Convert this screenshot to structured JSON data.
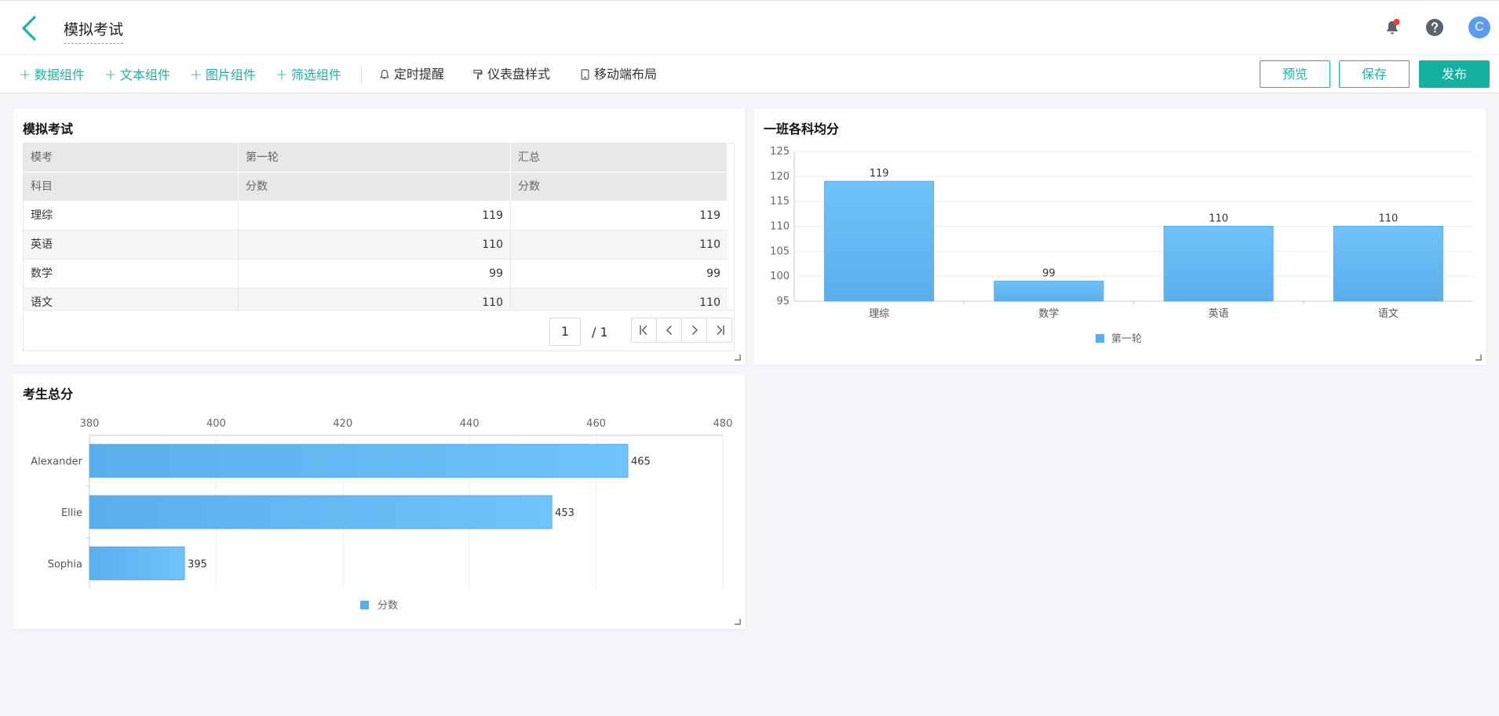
{
  "header": {
    "title": "模拟考试",
    "avatar_letter": "C"
  },
  "toolbar": {
    "add_items": [
      "数据组件",
      "文本组件",
      "图片组件",
      "筛选组件"
    ],
    "tools": [
      "定时提醒",
      "仪表盘样式",
      "移动端布局"
    ],
    "preview_label": "预览",
    "save_label": "保存",
    "publish_label": "发布"
  },
  "colors": {
    "accent": "#1bb3a3",
    "bar": "#64b8f6",
    "notification_dot": "#f04134"
  },
  "table_card": {
    "title": "模拟考试",
    "header_row1": [
      "模考",
      "第一轮",
      "汇总"
    ],
    "header_row2": [
      "科目",
      "分数",
      "分数"
    ],
    "rows": [
      [
        "理综",
        "119",
        "119"
      ],
      [
        "英语",
        "110",
        "110"
      ],
      [
        "数学",
        "99",
        "99"
      ],
      [
        "语文",
        "110",
        "110"
      ]
    ],
    "pager": {
      "current": "1",
      "total": "/ 1"
    }
  },
  "bar_card": {
    "title": "一班各科均分"
  },
  "hbar_card": {
    "title": "考生总分"
  },
  "chart_data": [
    {
      "type": "bar",
      "title": "一班各科均分",
      "categories": [
        "理综",
        "数学",
        "英语",
        "语文"
      ],
      "series": [
        {
          "name": "第一轮",
          "values": [
            119,
            99,
            110,
            110
          ]
        }
      ],
      "ylim": [
        95,
        125
      ],
      "yticks": [
        95,
        100,
        105,
        110,
        115,
        120,
        125
      ],
      "legend": "bottom-center",
      "grid": true
    },
    {
      "type": "bar",
      "orientation": "horizontal",
      "title": "考生总分",
      "categories": [
        "Alexander",
        "Ellie",
        "Sophia"
      ],
      "series": [
        {
          "name": "分数",
          "values": [
            465,
            453,
            395
          ]
        }
      ],
      "xlim": [
        380,
        480
      ],
      "xticks": [
        380,
        400,
        420,
        440,
        460,
        480
      ],
      "legend": "bottom-center",
      "grid": true
    }
  ]
}
